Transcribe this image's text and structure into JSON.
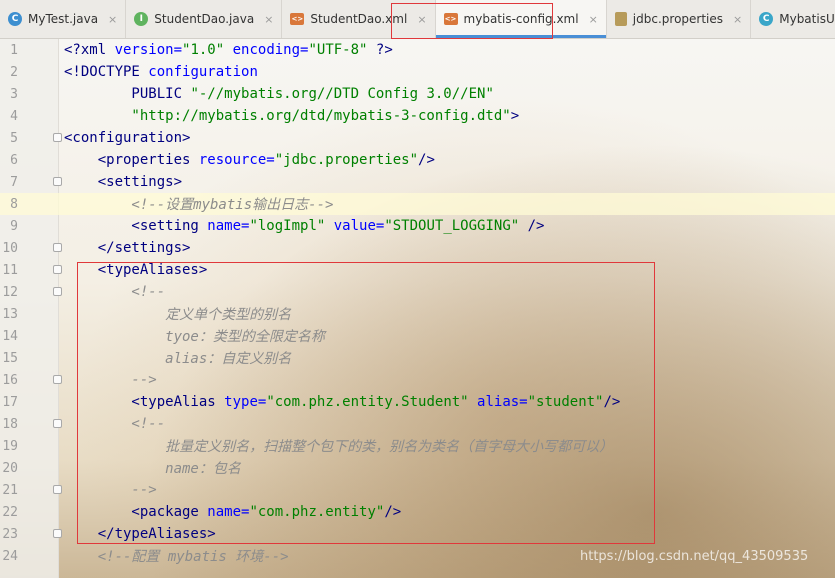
{
  "tabs": [
    {
      "label": "MyTest.java",
      "icon": "java-run-icon",
      "active": false
    },
    {
      "label": "StudentDao.java",
      "icon": "interface-icon",
      "active": false
    },
    {
      "label": "StudentDao.xml",
      "icon": "xml-file-icon",
      "active": false
    },
    {
      "label": "mybatis-config.xml",
      "icon": "xml-file-icon",
      "active": true
    },
    {
      "label": "jdbc.properties",
      "icon": "properties-file-icon",
      "active": false
    },
    {
      "label": "MybatisUtil.java",
      "icon": "class-icon",
      "active": false
    }
  ],
  "close_glyph": "×",
  "colors": {
    "tag": "#000080",
    "attr": "#0000ff",
    "value": "#008000",
    "comment": "#8c8c8c",
    "highlight_box": "#e0383b"
  },
  "lines": [
    {
      "n": "1",
      "parts": [
        [
          "kw",
          "<?xml "
        ],
        [
          "attr",
          "version="
        ],
        [
          "val",
          "\"1.0\""
        ],
        [
          "attr",
          " encoding="
        ],
        [
          "val",
          "\"UTF-8\""
        ],
        [
          "kw",
          " ?>"
        ]
      ]
    },
    {
      "n": "2",
      "parts": [
        [
          "kw",
          "<!DOCTYPE "
        ],
        [
          "attr",
          "configuration"
        ]
      ]
    },
    {
      "n": "3",
      "parts": [
        [
          "kw",
          "        PUBLIC "
        ],
        [
          "val",
          "\"-//mybatis.org//DTD Config 3.0//EN\""
        ]
      ]
    },
    {
      "n": "4",
      "parts": [
        [
          "val",
          "        \"http://mybatis.org/dtd/mybatis-3-config.dtd\""
        ],
        [
          "kw",
          ">"
        ]
      ]
    },
    {
      "n": "5",
      "parts": [
        [
          "tag",
          "<configuration>"
        ]
      ]
    },
    {
      "n": "6",
      "parts": [
        [
          "tag",
          "    <properties "
        ],
        [
          "attr",
          "resource="
        ],
        [
          "val",
          "\"jdbc.properties\""
        ],
        [
          "tag",
          "/>"
        ]
      ]
    },
    {
      "n": "7",
      "parts": [
        [
          "tag",
          "    <settings>"
        ]
      ]
    },
    {
      "n": "8",
      "parts": [
        [
          "com",
          "        <!--设置mybatis输出日志-->"
        ]
      ],
      "current": true
    },
    {
      "n": "9",
      "parts": [
        [
          "tag",
          "        <setting "
        ],
        [
          "attr",
          "name="
        ],
        [
          "val",
          "\"logImpl\""
        ],
        [
          "attr",
          " value="
        ],
        [
          "val",
          "\"STDOUT_LOGGING\""
        ],
        [
          "tag",
          " />"
        ]
      ]
    },
    {
      "n": "10",
      "parts": [
        [
          "tag",
          "    </settings>"
        ]
      ]
    },
    {
      "n": "11",
      "parts": [
        [
          "tag",
          "    <typeAliases>"
        ]
      ]
    },
    {
      "n": "12",
      "parts": [
        [
          "com",
          "        <!--"
        ]
      ]
    },
    {
      "n": "13",
      "parts": [
        [
          "com",
          "            定义单个类型的别名"
        ]
      ]
    },
    {
      "n": "14",
      "parts": [
        [
          "com",
          "            tyoe：类型的全限定名称"
        ]
      ]
    },
    {
      "n": "15",
      "parts": [
        [
          "com",
          "            alias：自定义别名"
        ]
      ]
    },
    {
      "n": "16",
      "parts": [
        [
          "com",
          "        -->"
        ]
      ]
    },
    {
      "n": "17",
      "parts": [
        [
          "tag",
          "        <typeAlias "
        ],
        [
          "attr",
          "type="
        ],
        [
          "val",
          "\"com.phz.entity.Student\""
        ],
        [
          "attr",
          " alias="
        ],
        [
          "val",
          "\"student\""
        ],
        [
          "tag",
          "/>"
        ]
      ]
    },
    {
      "n": "18",
      "parts": [
        [
          "com",
          "        <!--"
        ]
      ]
    },
    {
      "n": "19",
      "parts": [
        [
          "com",
          "            批量定义别名，扫描整个包下的类，别名为类名（首字母大小写都可以）"
        ]
      ]
    },
    {
      "n": "20",
      "parts": [
        [
          "com",
          "            name：包名"
        ]
      ]
    },
    {
      "n": "21",
      "parts": [
        [
          "com",
          "        -->"
        ]
      ]
    },
    {
      "n": "22",
      "parts": [
        [
          "tag",
          "        <package "
        ],
        [
          "attr",
          "name="
        ],
        [
          "val",
          "\"com.phz.entity\""
        ],
        [
          "tag",
          "/>"
        ]
      ]
    },
    {
      "n": "23",
      "parts": [
        [
          "tag",
          "    </typeAliases>"
        ]
      ]
    },
    {
      "n": "24",
      "parts": [
        [
          "com",
          "    <!--配置 mybatis 环境-->"
        ]
      ]
    }
  ],
  "watermark": "https://blog.csdn.net/qq_43509535"
}
